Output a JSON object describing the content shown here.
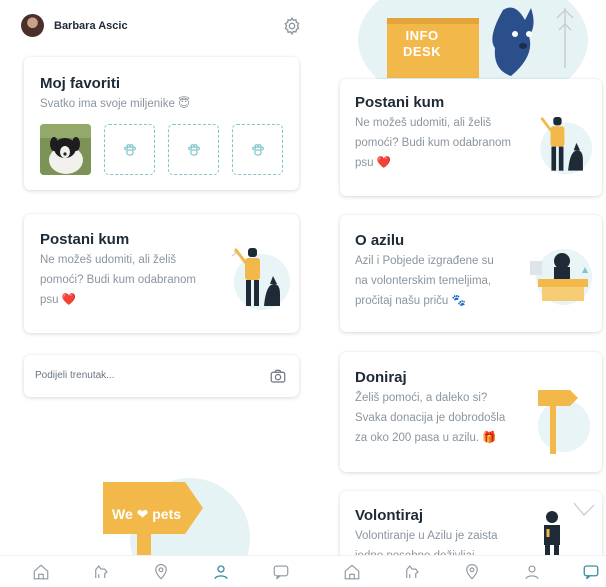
{
  "left": {
    "user": {
      "name": "Barbara Ascic"
    },
    "favorites": {
      "title": "Moj favoriti",
      "subtitle": "Svatko ima svoje miljenike 😇"
    },
    "sponsor": {
      "title": "Postani kum",
      "text_lines": [
        "Ne možeš udomiti, ali želiš",
        "pomoći? Budi kum odabranom",
        "psu ❤️"
      ]
    },
    "share": {
      "placeholder": "Podijeli trenutak..."
    },
    "sign": {
      "text": "We ❤ pets"
    }
  },
  "right": {
    "banner": {
      "sign_line1": "INFO",
      "sign_line2": "DESK"
    },
    "sponsor": {
      "title": "Postani kum",
      "text_lines": [
        "Ne možeš udomiti, ali želiš",
        "pomoći? Budi kum odabranom",
        "psu ❤️"
      ]
    },
    "about": {
      "title": "O azilu",
      "text_lines": [
        "Azil i Pobjede izgrađene su",
        "na volonterskim temeljima,",
        "pročitaj našu priču 🐾"
      ]
    },
    "donate": {
      "title": "Doniraj",
      "text_lines": [
        "Želiš pomoći, a daleko si?",
        "Svaka donacija je dobrodošla",
        "za oko 200 pasa u azilu. 🎁"
      ]
    },
    "volunteer": {
      "title": "Volontiraj",
      "text_lines": [
        "Volontiranje u Azilu je zaista",
        "jedno posebno doživljaj"
      ]
    }
  },
  "tabs": [
    "home-icon",
    "dog-icon",
    "location-icon",
    "profile-icon",
    "chat-icon"
  ],
  "colors": {
    "teal": "#7fc6c8",
    "yellow": "#f2b84a",
    "dark": "#1e2a36",
    "grey": "#8b959e",
    "active_tab": "#3a8fa3"
  }
}
